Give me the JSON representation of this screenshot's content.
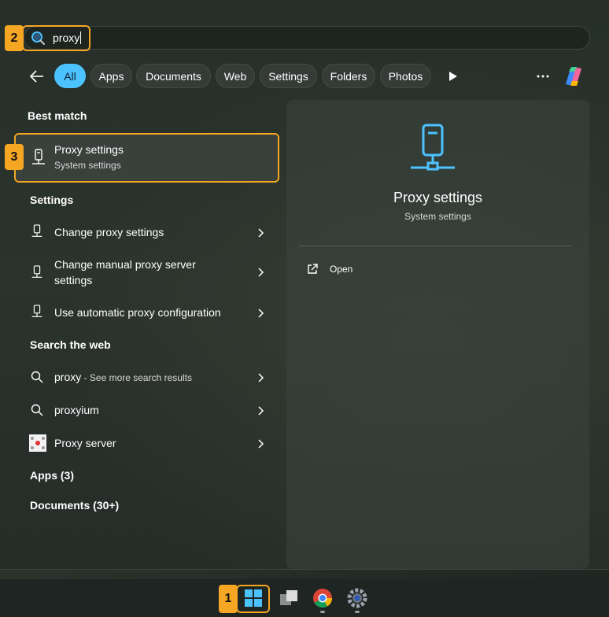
{
  "search": {
    "query": "proxy"
  },
  "callouts": {
    "taskbar_start": "1",
    "search_box": "2",
    "best_match": "3"
  },
  "filters": {
    "items": [
      "All",
      "Apps",
      "Documents",
      "Web",
      "Settings",
      "Folders",
      "Photos"
    ],
    "active": "All"
  },
  "best_match": {
    "heading": "Best match",
    "title": "Proxy settings",
    "subtitle": "System settings"
  },
  "settings_section": {
    "heading": "Settings",
    "items": [
      {
        "label": "Change proxy settings",
        "icon": "proxy-icon"
      },
      {
        "label": "Change manual proxy server settings",
        "icon": "proxy-icon"
      },
      {
        "label": "Use automatic proxy configuration",
        "icon": "proxy-icon"
      }
    ]
  },
  "web_section": {
    "heading": "Search the web",
    "items": [
      {
        "label": "proxy",
        "suffix": " - See more search results",
        "icon": "search-icon"
      },
      {
        "label": "proxyium",
        "suffix": "",
        "icon": "search-icon"
      },
      {
        "label": "Proxy server",
        "suffix": "",
        "icon": "image-thumbnail"
      }
    ]
  },
  "apps_section": {
    "heading": "Apps (3)"
  },
  "documents_section": {
    "heading": "Documents (30+)"
  },
  "preview": {
    "title": "Proxy settings",
    "subtitle": "System settings",
    "actions": [
      {
        "label": "Open",
        "icon": "open-external-icon"
      }
    ]
  },
  "taskbar": {
    "items": [
      "start-button",
      "task-view",
      "chrome",
      "settings"
    ]
  },
  "colors": {
    "accent": "#4cc2ff",
    "highlight": "#f5a623"
  }
}
